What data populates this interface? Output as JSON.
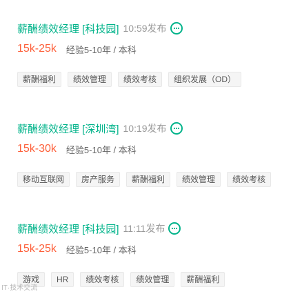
{
  "jobs": [
    {
      "title": "薪酬绩效经理 [科技园]",
      "time": "10:59发布",
      "salary": "15k-25k",
      "requirement": "经验5-10年 / 本科",
      "tags": [
        "薪酬福利",
        "绩效管理",
        "绩效考核",
        "组织发展（OD）"
      ]
    },
    {
      "title": "薪酬绩效经理 [深圳湾]",
      "time": "10:19发布",
      "salary": "15k-30k",
      "requirement": "经验5-10年 / 本科",
      "tags": [
        "移动互联网",
        "房产服务",
        "薪酬福利",
        "绩效管理",
        "绩效考核"
      ]
    },
    {
      "title": "薪酬绩效经理 [科技园]",
      "time": "11:11发布",
      "salary": "15k-25k",
      "requirement": "经验5-10年 / 本科",
      "tags": [
        "游戏",
        "HR",
        "绩效考核",
        "绩效管理",
        "薪酬福利"
      ]
    }
  ],
  "footer": {
    "logo_text": "IT·技术交流"
  },
  "icons": {
    "chat": "chat-bubble-icon"
  },
  "colors": {
    "title": "#00b38a",
    "salary": "#fd5f39",
    "time": "#999999",
    "tag_bg": "#f5f5f5"
  }
}
